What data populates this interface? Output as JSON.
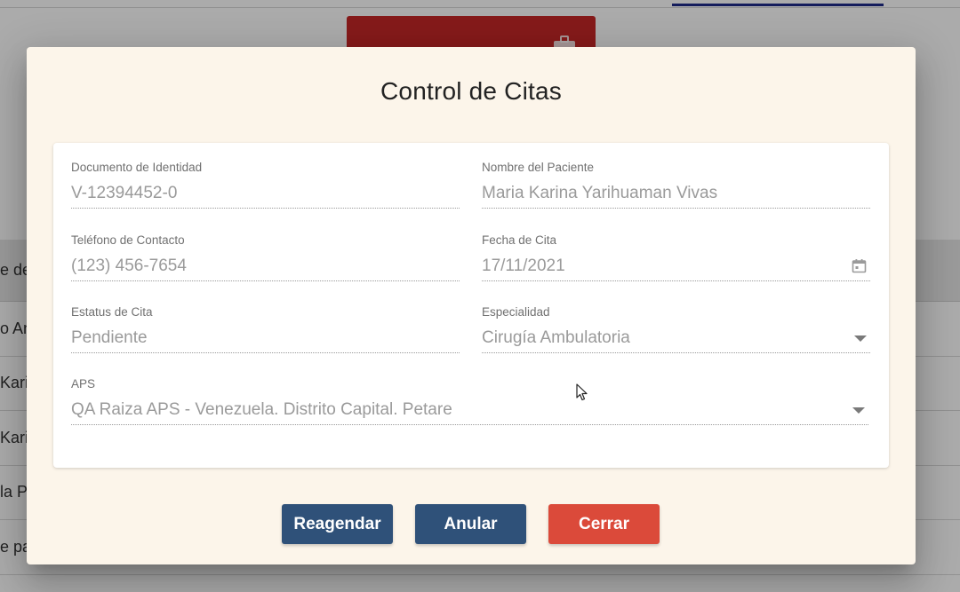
{
  "background": {
    "table_rows": [
      "e de",
      "o An",
      "Karin",
      "Karin",
      "la P",
      "e pa"
    ]
  },
  "modal": {
    "title": "Control de Citas",
    "fields": {
      "documento": {
        "label": "Documento de Identidad",
        "value": "V-12394452-0"
      },
      "nombre": {
        "label": "Nombre del Paciente",
        "value": "Maria Karina Yarihuaman Vivas"
      },
      "telefono": {
        "label": "Teléfono de Contacto",
        "value": "(123) 456-7654"
      },
      "fecha": {
        "label": "Fecha de Cita",
        "value": "17/11/2021",
        "icon": "calendar-icon"
      },
      "estatus": {
        "label": "Estatus de Cita",
        "value": "Pendiente"
      },
      "especialidad": {
        "label": "Especialidad",
        "value": "Cirugía Ambulatoria",
        "icon": "dropdown-arrow-icon"
      },
      "aps": {
        "label": "APS",
        "value": "QA Raiza APS - Venezuela. Distrito Capital. Petare",
        "icon": "dropdown-arrow-icon"
      }
    },
    "buttons": {
      "reagendar": "Reagendar",
      "anular": "Anular",
      "cerrar": "Cerrar"
    }
  },
  "colors": {
    "modal_bg": "#fcf5ea",
    "primary_button": "#2f5179",
    "danger_button": "#db4a3a",
    "background_card": "#c62828"
  }
}
